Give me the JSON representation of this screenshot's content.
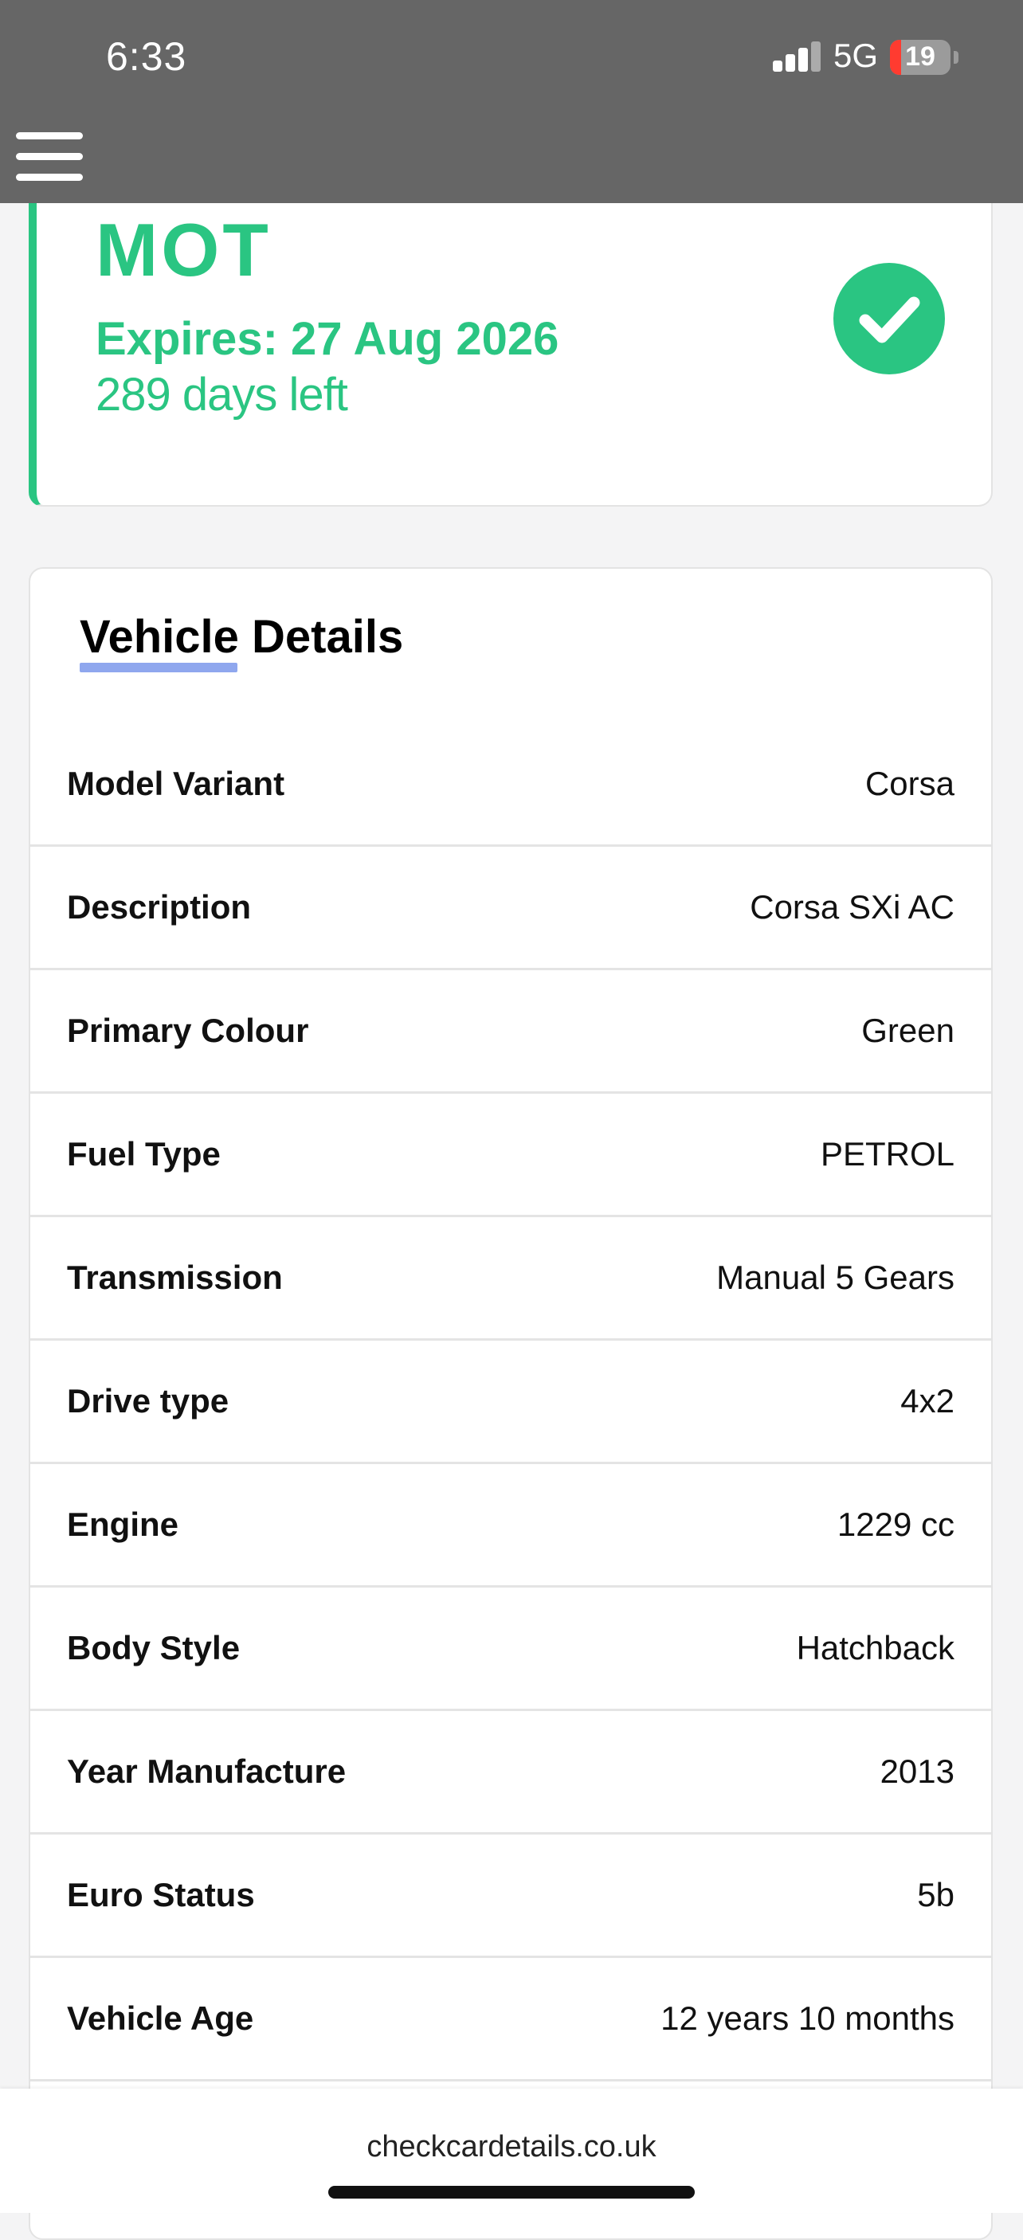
{
  "status_bar": {
    "time": "6:33",
    "network": "5G",
    "battery_level": "19",
    "battery_fraction": 0.19
  },
  "mot": {
    "title": "MOT",
    "expiry": "Expires: 27 Aug 2026",
    "days_left": "289 days left",
    "status_icon": "check-circle-icon",
    "accent_color": "#2ac582"
  },
  "vehicle_details": {
    "title": "Vehicle Details",
    "underline_color": "#8fa7ee",
    "rows": [
      {
        "label": "Model Variant",
        "value": "Corsa"
      },
      {
        "label": "Description",
        "value": "Corsa SXi AC"
      },
      {
        "label": "Primary Colour",
        "value": "Green"
      },
      {
        "label": "Fuel Type",
        "value": "PETROL"
      },
      {
        "label": "Transmission",
        "value": "Manual 5 Gears"
      },
      {
        "label": "Drive type",
        "value": "4x2"
      },
      {
        "label": "Engine",
        "value": "1229 cc"
      },
      {
        "label": "Body Style",
        "value": "Hatchback"
      },
      {
        "label": "Year Manufacture",
        "value": "2013"
      },
      {
        "label": "Euro Status",
        "value": "5b"
      },
      {
        "label": "Vehicle Age",
        "value": "12 years 10 months"
      }
    ]
  },
  "browser": {
    "url": "checkcardetails.co.uk"
  }
}
